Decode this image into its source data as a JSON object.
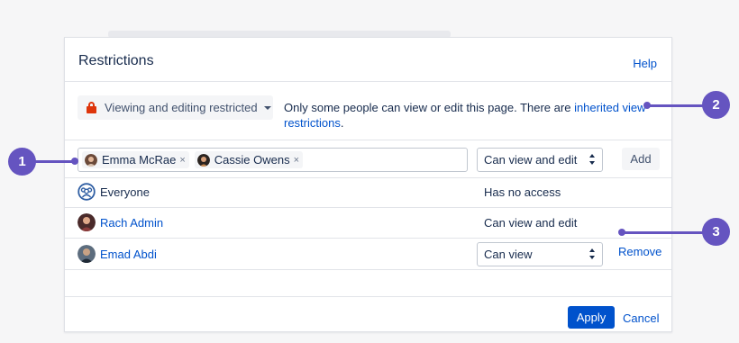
{
  "dialog": {
    "title": "Restrictions",
    "help_label": "Help"
  },
  "restriction": {
    "dropdown_label": "Viewing and editing restricted",
    "info_prefix": "Only some people can view or edit this page.  There are ",
    "info_link": "inherited view restrictions",
    "info_suffix": "."
  },
  "picker": {
    "chips": [
      {
        "label": "Emma McRae",
        "remove": "×"
      },
      {
        "label": "Cassie Owens",
        "remove": "×"
      }
    ],
    "permission_value": "Can view and edit",
    "add_label": "Add"
  },
  "entries": [
    {
      "name": "Everyone",
      "permission": "Has no access"
    },
    {
      "name": "Rach Admin",
      "permission": "Can view and edit"
    },
    {
      "name": "Emad Abdi",
      "permission": "Can view",
      "remove_label": "Remove"
    }
  ],
  "footer": {
    "apply_label": "Apply",
    "cancel_label": "Cancel"
  },
  "callouts": [
    "1",
    "2",
    "3"
  ],
  "colors": {
    "accent": "#0052cc",
    "lock": "#de350b",
    "callout": "#6554c0"
  }
}
